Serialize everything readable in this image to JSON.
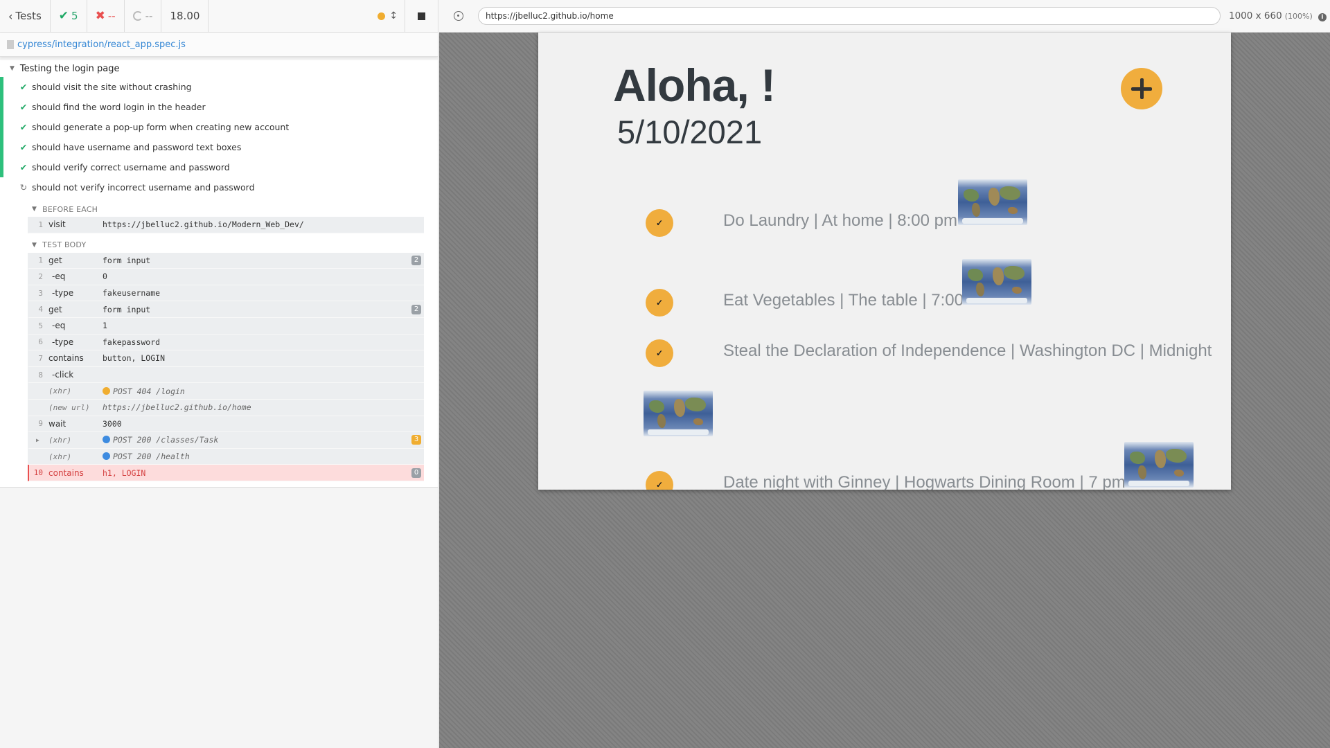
{
  "reporter": {
    "header": {
      "back_label": "Tests",
      "passed": "5",
      "failed": "--",
      "pending": "--",
      "duration": "18.00"
    },
    "spec_path": "cypress/integration/react_app.spec.js",
    "suite": {
      "title": "Testing the login page",
      "tests": [
        {
          "title": "should visit the site without crashing",
          "state": "passed"
        },
        {
          "title": "should find the word login in the header",
          "state": "passed"
        },
        {
          "title": "should generate a pop-up form when creating new account",
          "state": "passed"
        },
        {
          "title": "should have username and password text boxes",
          "state": "passed"
        },
        {
          "title": "should verify correct username and password",
          "state": "passed"
        },
        {
          "title": "should not verify incorrect username and password",
          "state": "running"
        }
      ]
    },
    "before_each": {
      "title": "BEFORE EACH",
      "commands": [
        {
          "num": "1",
          "name": "visit",
          "message": "https://jbelluc2.github.io/Modern_Web_Dev/"
        }
      ]
    },
    "test_body": {
      "title": "TEST BODY",
      "commands": [
        {
          "num": "1",
          "name": "get",
          "message": "form input",
          "badge": "2",
          "kind": "parent"
        },
        {
          "num": "2",
          "name": "-eq",
          "message": "0",
          "kind": "child"
        },
        {
          "num": "3",
          "name": "-type",
          "message": "fakeusername",
          "kind": "child"
        },
        {
          "num": "4",
          "name": "get",
          "message": "form input",
          "badge": "2",
          "kind": "parent"
        },
        {
          "num": "5",
          "name": "-eq",
          "message": "1",
          "kind": "child"
        },
        {
          "num": "6",
          "name": "-type",
          "message": "fakepassword",
          "kind": "child"
        },
        {
          "num": "7",
          "name": "contains",
          "message": "button, LOGIN",
          "kind": "parent"
        },
        {
          "num": "8",
          "name": "-click",
          "message": "",
          "kind": "child"
        },
        {
          "num": "",
          "name": "(xhr)",
          "message": "POST 404 /login",
          "kind": "event",
          "dot": "orange"
        },
        {
          "num": "",
          "name": "(new url)",
          "message": "https://jbelluc2.github.io/home",
          "kind": "event"
        },
        {
          "num": "9",
          "name": "wait",
          "message": "3000",
          "kind": "parent"
        },
        {
          "num": "",
          "name": "(xhr)",
          "message": "POST 200 /classes/Task",
          "kind": "event",
          "dot": "blue",
          "badge": "3",
          "badge_color": "orange",
          "expandable": true
        },
        {
          "num": "",
          "name": "(xhr)",
          "message": "POST 200 /health",
          "kind": "event",
          "dot": "blue"
        },
        {
          "num": "10",
          "name": "contains",
          "message": "h1, LOGIN",
          "badge": "0",
          "kind": "failed"
        }
      ]
    }
  },
  "aut": {
    "url": "https://jbelluc2.github.io/home",
    "viewport": "1000 x 660",
    "zoom": "(100%)",
    "app": {
      "greeting": "Aloha, !",
      "date": "5/10/2021",
      "tasks": [
        {
          "text": "Do Laundry | At home | 8:00 pm",
          "check": "✓"
        },
        {
          "text": "Eat Vegetables | The table | 7:00",
          "check": "✓"
        },
        {
          "text": "Steal the Declaration of Independence | Washington DC | Midnight",
          "check": "✓"
        },
        {
          "text": "Date night with Ginney | Hogwarts Dining Room | 7 pm",
          "check": "✓"
        }
      ]
    }
  },
  "colors": {
    "pass": "#1fa865",
    "fail": "#e94f4f",
    "accent_orange": "#f0ad3d",
    "link_blue": "#3386d4"
  }
}
